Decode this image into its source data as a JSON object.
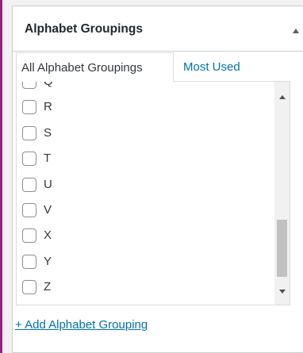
{
  "metabox": {
    "title": "Alphabet Groupings"
  },
  "tabs": [
    {
      "label": "All Alphabet Groupings",
      "active": true
    },
    {
      "label": "Most Used",
      "active": false
    }
  ],
  "items": [
    {
      "label": "Q",
      "checked": false
    },
    {
      "label": "R",
      "checked": false
    },
    {
      "label": "S",
      "checked": false
    },
    {
      "label": "T",
      "checked": false
    },
    {
      "label": "U",
      "checked": false
    },
    {
      "label": "V",
      "checked": false
    },
    {
      "label": "X",
      "checked": false
    },
    {
      "label": "Y",
      "checked": false
    },
    {
      "label": "Z",
      "checked": false
    }
  ],
  "add_link": "+ Add Alphabet Grouping",
  "colors": {
    "accent_border": "#9c1e7d",
    "link": "#0073aa",
    "text": "#32373c"
  },
  "icons": {
    "toggle": "triangle-up-icon",
    "scroll_up": "scroll-up-arrow-icon",
    "scroll_down": "scroll-down-arrow-icon"
  }
}
